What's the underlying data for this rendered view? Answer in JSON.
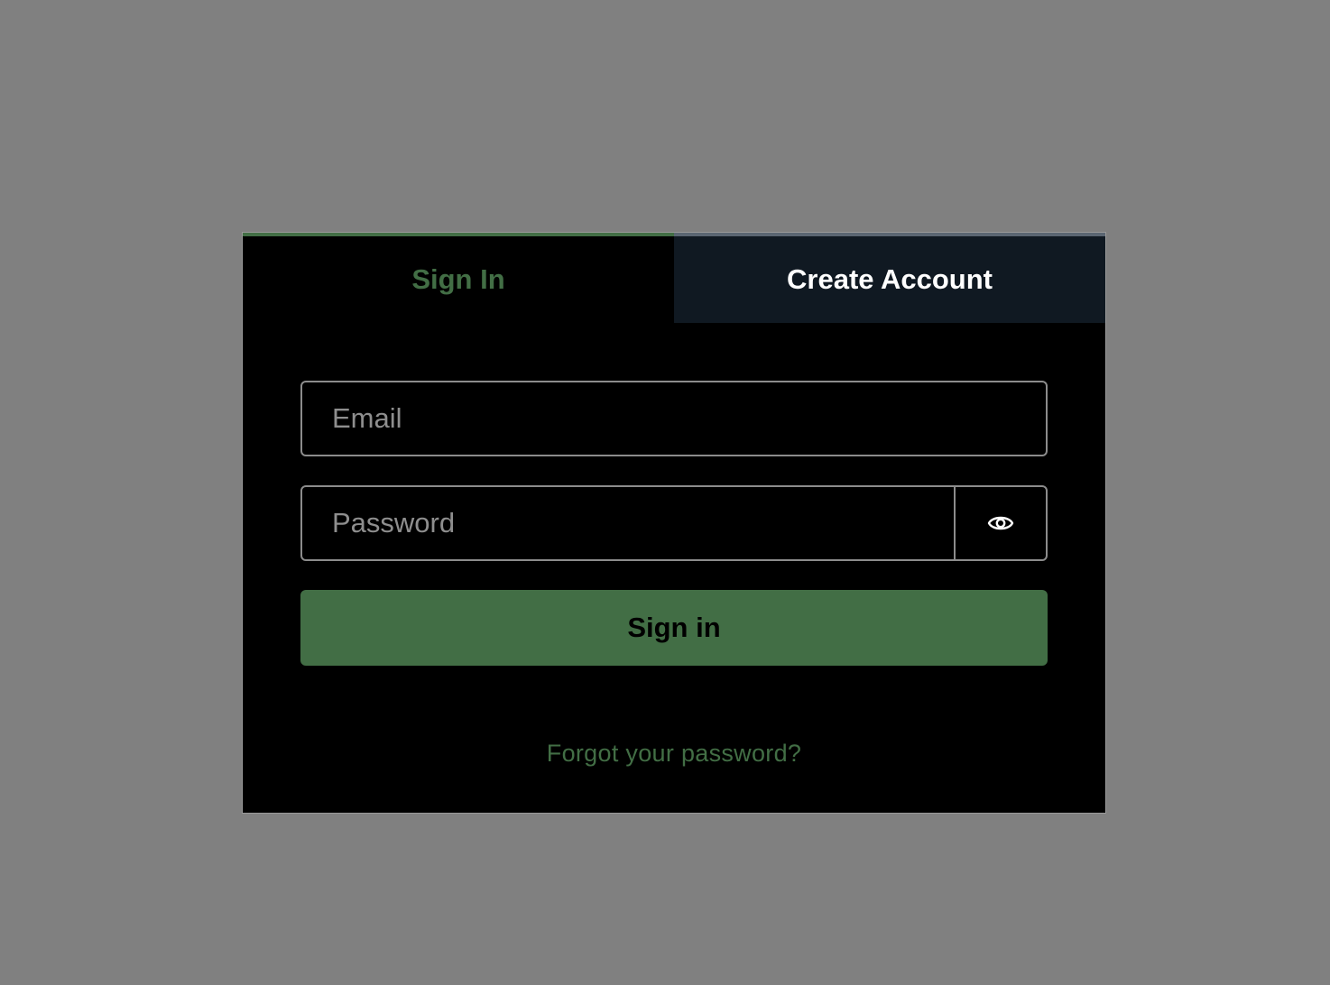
{
  "tabs": {
    "sign_in": "Sign In",
    "create_account": "Create Account"
  },
  "form": {
    "email_placeholder": "Email",
    "password_placeholder": "Password",
    "show_password_icon": "eye-icon",
    "submit_label": "Sign in",
    "forgot_link": "Forgot your password?"
  },
  "colors": {
    "accent": "#426e45",
    "card_background": "#000000",
    "inactive_tab_background": "#101922",
    "page_background": "#808080"
  }
}
